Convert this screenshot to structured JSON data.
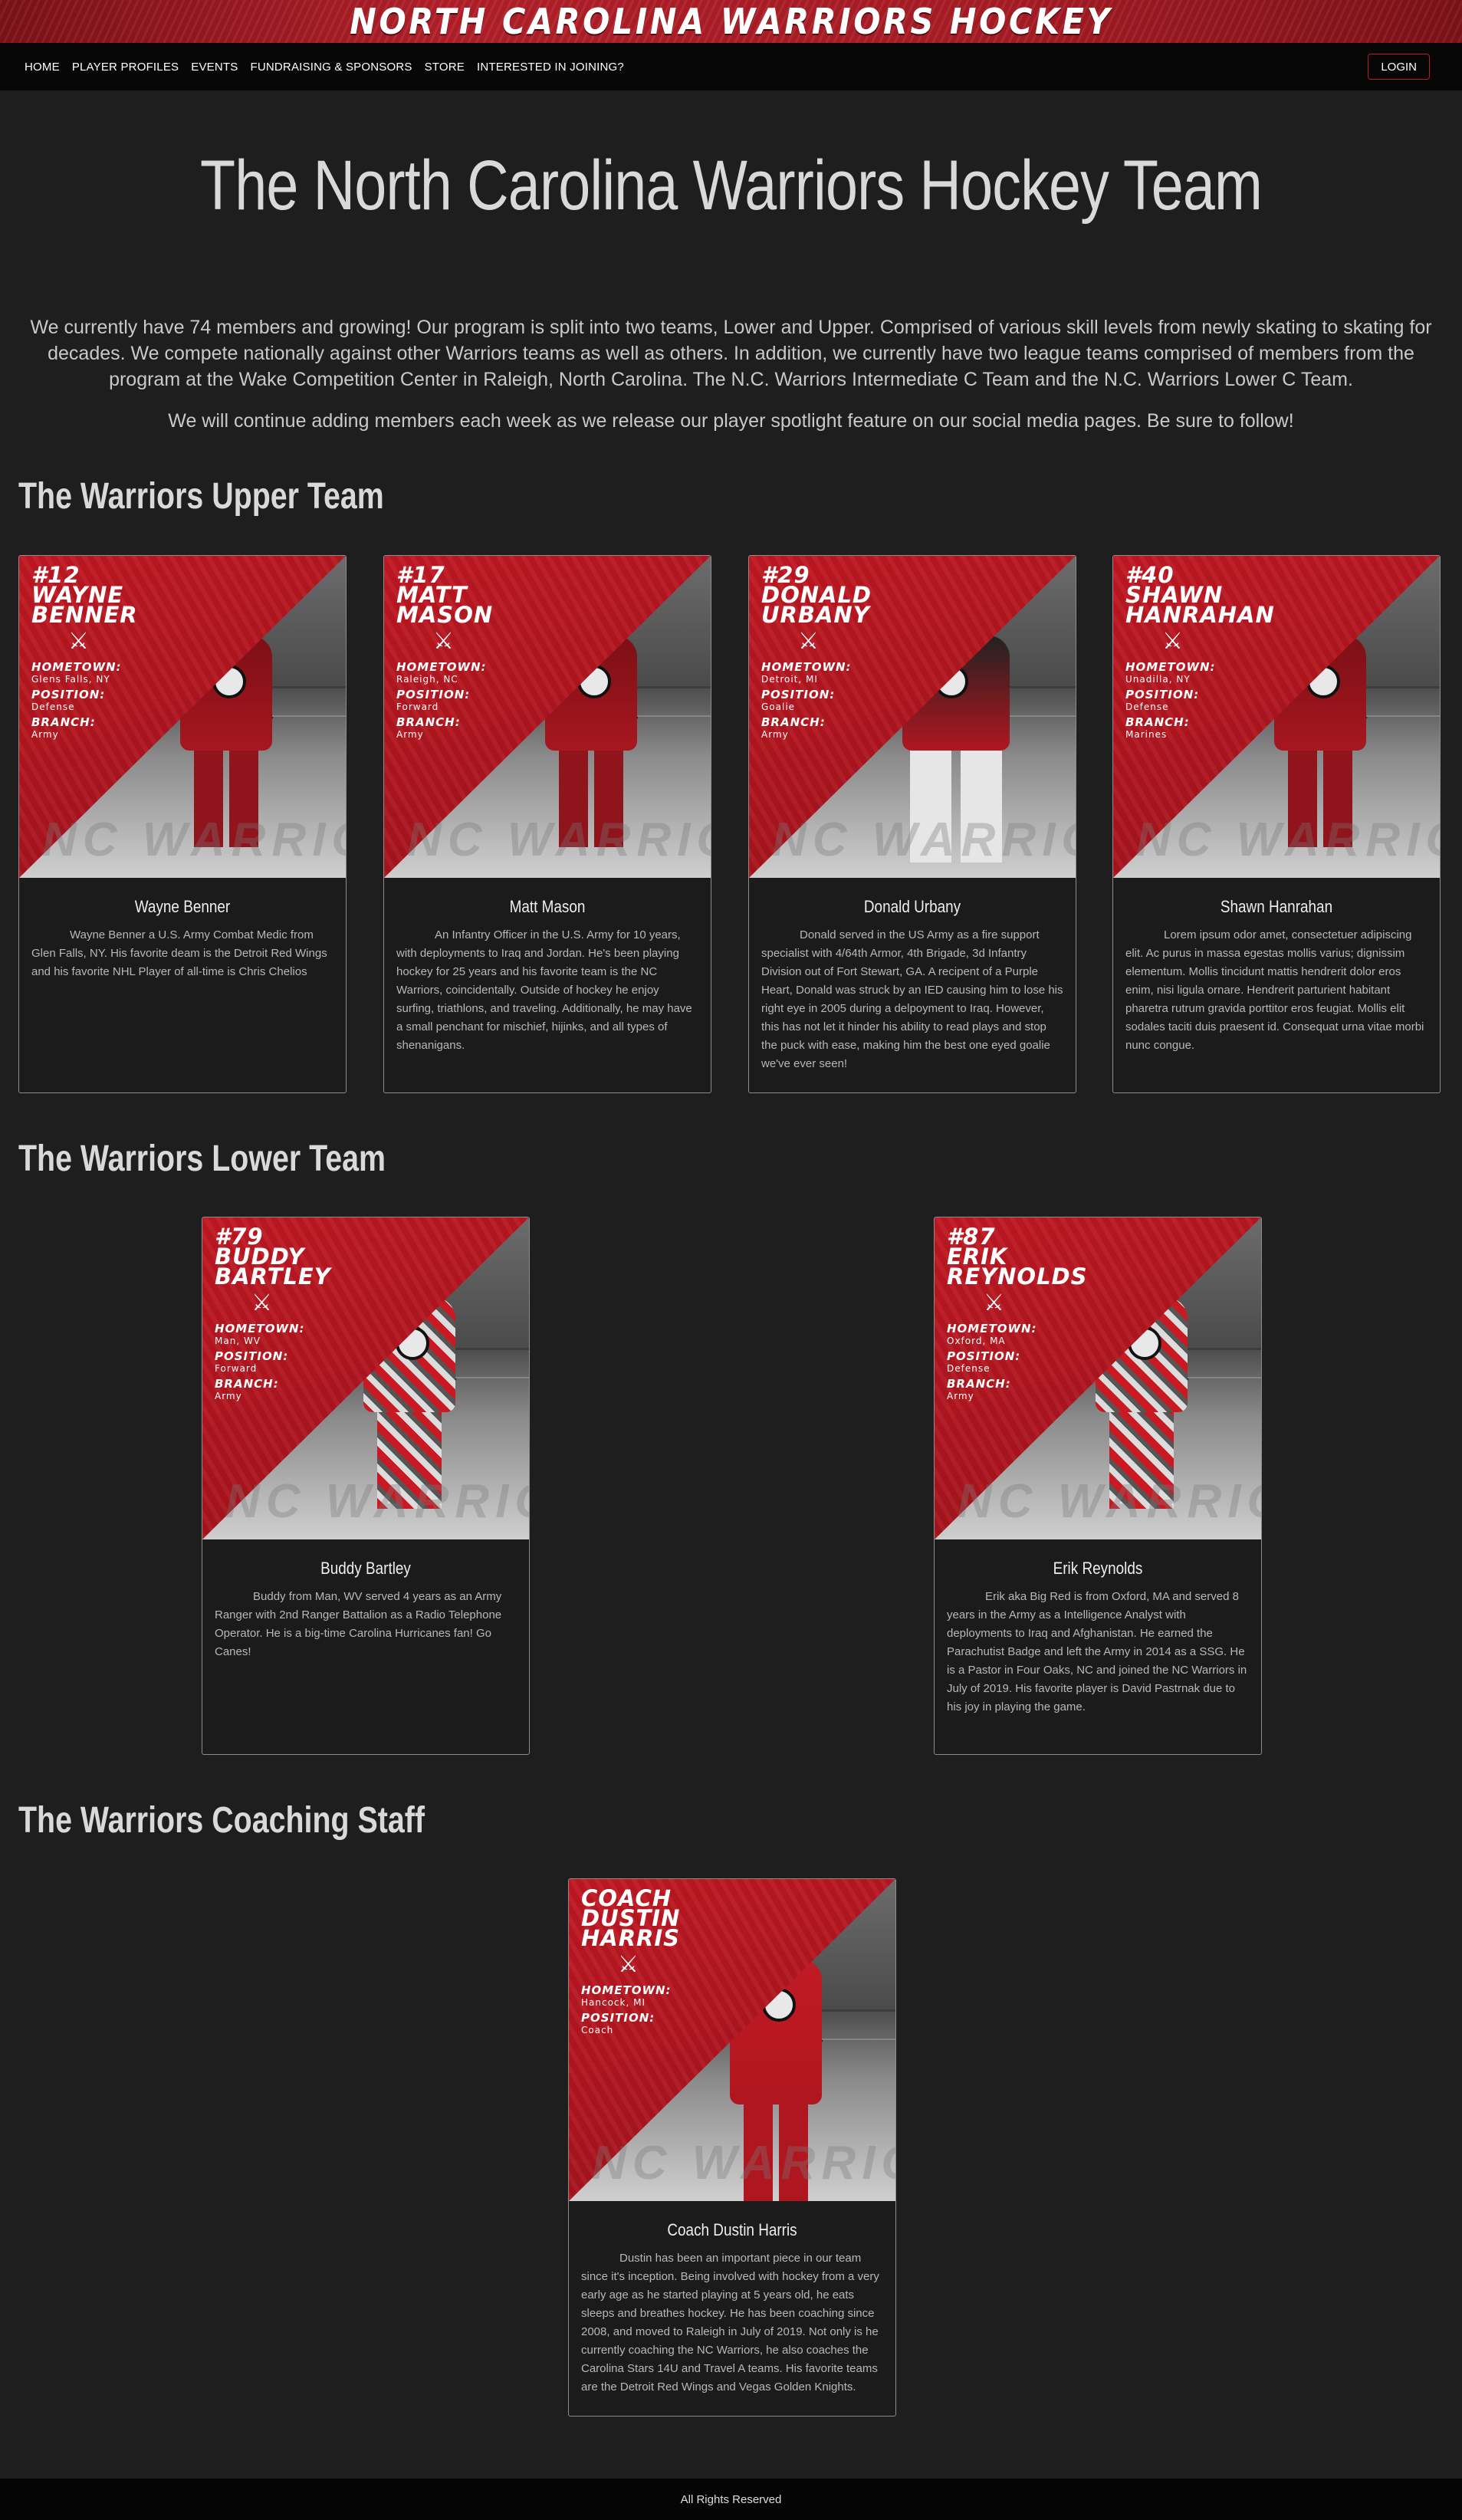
{
  "banner": {
    "title": "NORTH CAROLINA WARRIORS HOCKEY"
  },
  "nav": {
    "items": [
      "HOME",
      "PLAYER PROFILES",
      "EVENTS",
      "FUNDRAISING & SPONSORS",
      "STORE",
      "INTERESTED IN JOINING?"
    ],
    "login": "LOGIN"
  },
  "page_title": "The North Carolina Warriors Hockey Team",
  "intro": {
    "p1": "We currently have 74 members and growing! Our program is split into two teams, Lower and Upper. Comprised of various skill levels from newly skating to skating for decades. We compete nationally against other Warriors teams as well as others. In addition, we currently have two league teams comprised of members from the program at the Wake Competition Center in Raleigh, North Carolina. The N.C. Warriors Intermediate C Team and the N.C. Warriors Lower C Team.",
    "p2": "We will continue adding members each week as we release our player spotlight feature on our social media pages. Be sure to follow!"
  },
  "labels": {
    "hometown": "HOMETOWN:",
    "position": "POSITION:",
    "branch": "BRANCH:",
    "watermark": "NC WARRIORS"
  },
  "sections": {
    "upper": "The Warriors Upper Team",
    "lower": "The Warriors Lower Team",
    "coaching": "The Warriors Coaching Staff"
  },
  "players": [
    {
      "jersey": "#12",
      "first": "WAYNE",
      "last": "BENNER",
      "hometown": "Glens Falls, NY",
      "position": "Defense",
      "branch": "Army",
      "name": "Wayne Benner",
      "bio": "Wayne Benner a U.S. Army Combat Medic from Glen Falls, NY. His favorite deam is the Detroit Red Wings and his favorite NHL Player of all-time is Chris Chelios"
    },
    {
      "jersey": "#17",
      "first": "MATT",
      "last": "MASON",
      "hometown": "Raleigh, NC",
      "position": "Forward",
      "branch": "Army",
      "name": "Matt Mason",
      "bio": "An Infantry Officer in the U.S. Army for 10 years, with deployments to Iraq and Jordan. He's been playing hockey for 25 years and his favorite team is the NC Warriors, coincidentally. Outside of hockey he enjoy surfing, triathlons, and traveling. Additionally, he may have a small penchant for mischief, hijinks, and all types of shenanigans."
    },
    {
      "jersey": "#29",
      "first": "DONALD",
      "last": "URBANY",
      "hometown": "Detroit, MI",
      "position": "Goalie",
      "branch": "Army",
      "name": "Donald Urbany",
      "bio": "Donald served in the US Army as a fire support specialist with 4/64th Armor, 4th Brigade, 3d Infantry Division out of Fort Stewart, GA. A recipent of a Purple Heart, Donald was struck by an IED causing him to lose his right eye in 2005 during a delpoyment to Iraq. However, this has not let it hinder his ability to read plays and stop the puck with ease, making him the best one eyed goalie we've ever seen!"
    },
    {
      "jersey": "#40",
      "first": "SHAWN",
      "last": "HANRAHAN",
      "hometown": "Unadilla, NY",
      "position": "Defense",
      "branch": "Marines",
      "name": "Shawn Hanrahan",
      "bio": "Lorem ipsum odor amet, consectetuer adipiscing elit. Ac purus in massa egestas mollis varius; dignissim elementum. Mollis tincidunt mattis hendrerit dolor eros enim, nisi ligula ornare. Hendrerit parturient habitant pharetra rutrum gravida porttitor eros feugiat. Mollis elit sodales taciti duis praesent id. Consequat urna vitae morbi nunc congue."
    },
    {
      "jersey": "#79",
      "first": "BUDDY",
      "last": "BARTLEY",
      "hometown": "Man, WV",
      "position": "Forward",
      "branch": "Army",
      "name": "Buddy Bartley",
      "bio": "Buddy from Man, WV served 4 years as an Army Ranger with 2nd Ranger Battalion as a Radio Telephone Operator. He is a big-time Carolina Hurricanes fan! Go Canes!"
    },
    {
      "jersey": "#87",
      "first": "ERIK",
      "last": "REYNOLDS",
      "hometown": "Oxford, MA",
      "position": "Defense",
      "branch": "Army",
      "name": "Erik Reynolds",
      "bio": "Erik aka Big Red is from Oxford, MA and served 8 years in the Army as a Intelligence Analyst with deployments to Iraq and Afghanistan. He earned the Parachutist Badge and left the Army in 2014 as a SSG. He is a Pastor in Four Oaks, NC and joined the NC Warriors in July of 2019. His favorite player is David Pastrnak due to his joy in playing the game."
    },
    {
      "jersey": "COACH",
      "first": "DUSTIN",
      "last": "HARRIS",
      "hometown": "Hancock, MI",
      "position": "Coach",
      "branch": "",
      "name": "Coach Dustin Harris",
      "bio": "Dustin has been an important piece in our team since it's inception. Being involved with hockey from a very early age as he started playing at 5 years old, he eats sleeps and breathes hockey. He has been coaching since 2008, and moved to Raleigh in July of 2019. Not only is he currently coaching the NC Warriors, he also coaches the Carolina Stars 14U and Travel A teams. His favorite teams are the Detroit Red Wings and Vegas Golden Knights."
    }
  ],
  "footer": "All Rights Reserved"
}
